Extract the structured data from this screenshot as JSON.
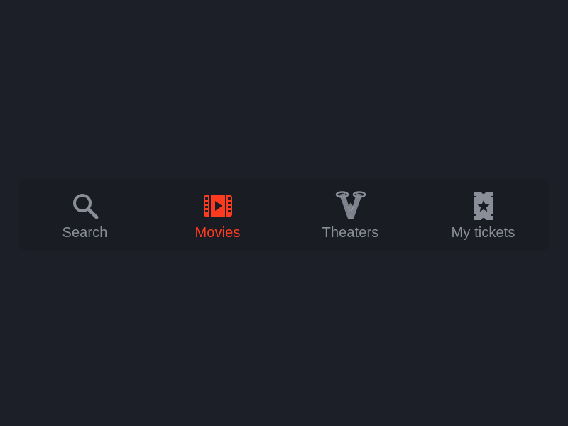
{
  "tabbar": {
    "items": [
      {
        "id": "search",
        "label": "Search",
        "icon": "search-icon",
        "active": false
      },
      {
        "id": "movies",
        "label": "Movies",
        "icon": "film-icon",
        "active": true
      },
      {
        "id": "theaters",
        "label": "Theaters",
        "icon": "spotlight-icon",
        "active": false
      },
      {
        "id": "tickets",
        "label": "My tickets",
        "icon": "ticket-icon",
        "active": false
      }
    ]
  },
  "colors": {
    "background": "#1d1f28",
    "tabbar_background": "#1a1c24",
    "inactive": "#8a8e98",
    "active": "#ff3b1f"
  }
}
